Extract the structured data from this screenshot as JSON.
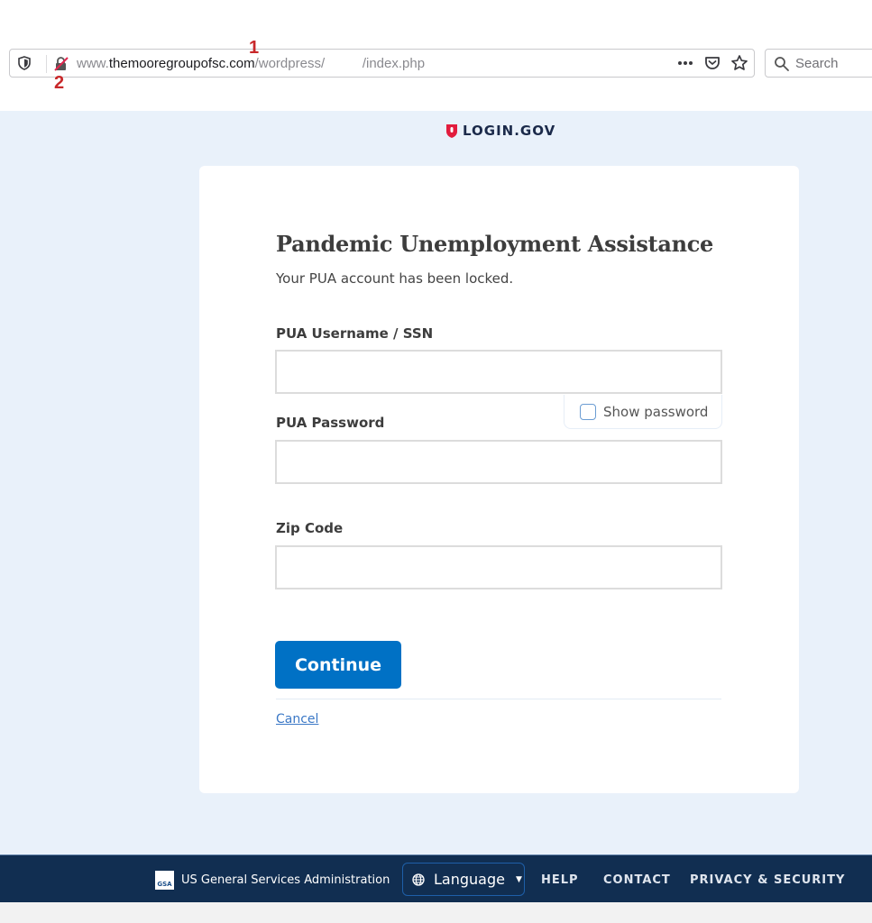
{
  "browser": {
    "url_prefix": "www.",
    "url_host": "themooregroupofsc.com",
    "url_path_start": "/wordpress/",
    "url_path_end": "/index.php",
    "search_placeholder": "Search",
    "annotations": [
      "1",
      "2"
    ]
  },
  "brand": {
    "name": "LOGIN.GOV",
    "accent_color": "#e21c3d"
  },
  "form": {
    "title": "Pandemic Unemployment Assistance",
    "subtitle": "Your PUA account has been locked.",
    "fields": [
      {
        "label": "PUA Username / SSN",
        "value": "",
        "placeholder": ""
      },
      {
        "label": "PUA Password",
        "value": "",
        "placeholder": ""
      },
      {
        "label": "Zip Code",
        "value": "",
        "placeholder": ""
      }
    ],
    "show_password_label": "Show password",
    "show_password_checked": false,
    "continue_label": "Continue",
    "cancel_label": "Cancel",
    "primary_color": "#0071c5"
  },
  "footer": {
    "gsa_logo_text": "GSA",
    "agency": "US General Services Administration",
    "language_label": "Language",
    "links": [
      "HELP",
      "CONTACT",
      "PRIVACY & SECURITY"
    ],
    "background_color": "#112e51"
  }
}
